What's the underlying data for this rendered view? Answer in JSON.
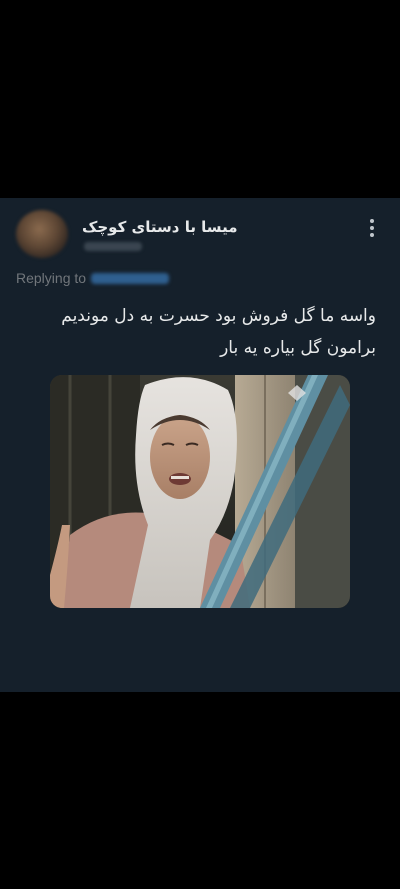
{
  "tweet": {
    "display_name": "میسا با دستای کوچک",
    "reply_prefix": "Replying to",
    "text_lines": [
      "واسه ما گل فروش بود حسرت به دل موندیم",
      "برامون گل بیاره یه بار"
    ],
    "media": {
      "description_icon": "photo-media"
    }
  },
  "colors": {
    "background": "#000000",
    "card": "#15202b",
    "text_primary": "#e7e9ea",
    "text_secondary": "#71767b",
    "link": "#1d9bf0"
  }
}
